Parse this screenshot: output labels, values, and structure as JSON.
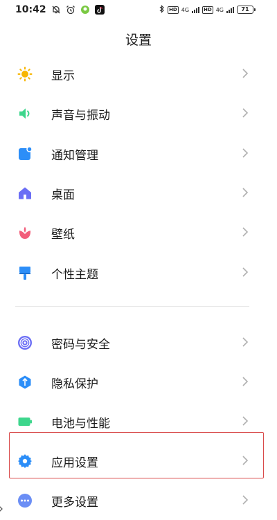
{
  "status_bar": {
    "time": "10:42",
    "network_1": "4G",
    "network_2": "4G",
    "battery": "71"
  },
  "header": {
    "title": "设置"
  },
  "settings": {
    "items": [
      {
        "label": "显示",
        "icon": "brightness-icon",
        "color": "#f7b500"
      },
      {
        "label": "声音与振动",
        "icon": "speaker-icon",
        "color": "#3dd68c"
      },
      {
        "label": "通知管理",
        "icon": "notification-icon",
        "color": "#2c8ef8"
      },
      {
        "label": "桌面",
        "icon": "home-icon",
        "color": "#6b6ef5"
      },
      {
        "label": "壁纸",
        "icon": "flower-icon",
        "color": "#f25d7a"
      },
      {
        "label": "个性主题",
        "icon": "paint-brush-icon",
        "color": "#2c8ef8"
      },
      {
        "label": "密码与安全",
        "icon": "fingerprint-icon",
        "color": "#6b6ef5"
      },
      {
        "label": "隐私保护",
        "icon": "shield-icon",
        "color": "#2c8ef8"
      },
      {
        "label": "电池与性能",
        "icon": "battery-icon",
        "color": "#3dd68c"
      },
      {
        "label": "应用设置",
        "icon": "gear-icon",
        "color": "#2c8ef8"
      },
      {
        "label": "更多设置",
        "icon": "more-icon",
        "color": "#6b8ef5"
      }
    ]
  },
  "colors": {
    "highlight": "#d94a4a",
    "chevron": "#b0b0b0"
  }
}
